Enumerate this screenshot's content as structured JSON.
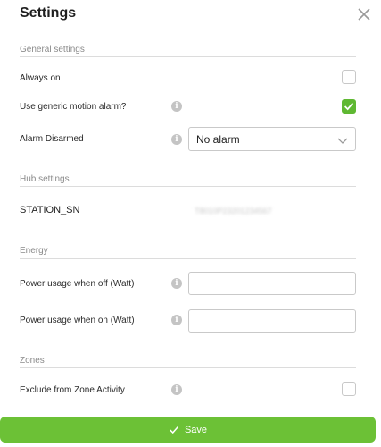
{
  "dialog": {
    "title": "Settings"
  },
  "icons": {
    "close": "close-icon",
    "info": "info-icon",
    "check": "check-icon",
    "chevron": "chevron-down-icon"
  },
  "colors": {
    "accent": "#6cc136",
    "checkbox_checked": "#5fb832",
    "divider": "#dcdcdc",
    "section_text": "#8a8a8a"
  },
  "general": {
    "title": "General settings",
    "always_on": {
      "label": "Always on",
      "checked": false
    },
    "motion_alarm": {
      "label": "Use generic motion alarm?",
      "checked": true
    },
    "alarm_disarmed": {
      "label": "Alarm Disarmed",
      "value": "No alarm"
    }
  },
  "hub": {
    "title": "Hub settings",
    "station_sn": {
      "label": "STATION_SN",
      "value": "T8010P23201234567"
    }
  },
  "energy": {
    "title": "Energy",
    "power_off": {
      "label": "Power usage when off (Watt)",
      "value": ""
    },
    "power_on": {
      "label": "Power usage when on (Watt)",
      "value": ""
    }
  },
  "zones": {
    "title": "Zones",
    "exclude": {
      "label": "Exclude from Zone Activity",
      "checked": false
    }
  },
  "footer": {
    "save_label": "Save"
  }
}
